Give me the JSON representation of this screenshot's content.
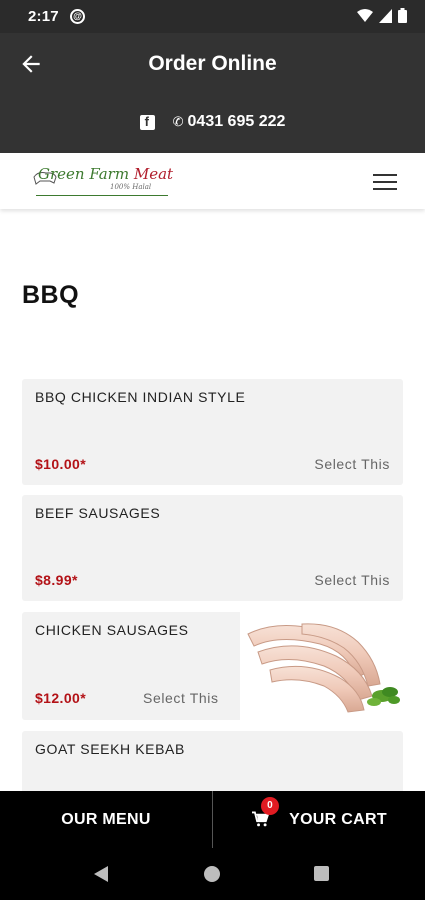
{
  "status_bar": {
    "time": "2:17",
    "app_icon_letter": "@"
  },
  "app_bar": {
    "title": "Order Online",
    "phone": "0431 695 222"
  },
  "logo": {
    "text_green": "Green Farm ",
    "text_red": "Meat",
    "tagline": "100% Halal"
  },
  "category": {
    "title": "BBQ"
  },
  "products": [
    {
      "name": "BBQ CHICKEN INDIAN STYLE",
      "price": "$10.00*",
      "action": "Select This"
    },
    {
      "name": "BEEF SAUSAGES",
      "price": "$8.99*",
      "action": "Select This"
    },
    {
      "name": "CHICKEN SAUSAGES",
      "price": "$12.00*",
      "action": "Select This"
    },
    {
      "name": "GOAT SEEKH KEBAB"
    }
  ],
  "bottom_bar": {
    "menu_label": "OUR MENU",
    "cart_label": "YOUR CART",
    "cart_count": "0"
  },
  "colors": {
    "price": "#b31217",
    "badge": "#e11b22",
    "app_bar": "#333333"
  }
}
